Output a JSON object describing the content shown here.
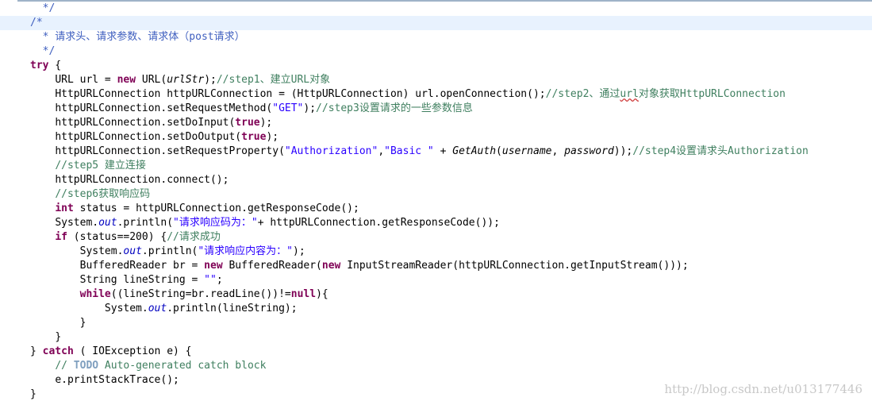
{
  "colors": {
    "keyword": "#7f0055",
    "comment": "#3f7f5f",
    "javadoc": "#3f5fbf",
    "string": "#2a00ff",
    "field": "#0000c0",
    "todo": "#7f9fbf",
    "highlight": "#e8f2fe",
    "watermark": "#c8c8c8"
  },
  "watermark": "http://blog.csdn.net/u013177446",
  "lines": [
    {
      "indent": "  ",
      "tokens": [
        {
          "c": "jd",
          "t": "*/"
        }
      ]
    },
    {
      "indent": "",
      "hl": true,
      "tokens": [
        {
          "c": "jd",
          "t": "/*"
        }
      ]
    },
    {
      "indent": "  ",
      "tokens": [
        {
          "c": "jd",
          "t": "* 请求头、请求参数、请求体（post请求）"
        }
      ]
    },
    {
      "indent": "  ",
      "tokens": [
        {
          "c": "jd",
          "t": "*/"
        }
      ]
    },
    {
      "indent": "",
      "tokens": [
        {
          "c": "kw",
          "t": "try"
        },
        {
          "c": "",
          "t": " {"
        }
      ]
    },
    {
      "indent": "    ",
      "tokens": [
        {
          "c": "",
          "t": "URL url = "
        },
        {
          "c": "kw",
          "t": "new"
        },
        {
          "c": "",
          "t": " URL("
        },
        {
          "c": "it",
          "t": "urlStr"
        },
        {
          "c": "",
          "t": ");"
        },
        {
          "c": "cm",
          "t": "//step1、建立URL对象"
        }
      ]
    },
    {
      "indent": "    ",
      "tokens": [
        {
          "c": "",
          "t": "HttpURLConnection httpURLConnection = (HttpURLConnection) url.openConnection();"
        },
        {
          "c": "cm",
          "t": "//step2、通过"
        },
        {
          "c": "cm uline",
          "t": "url"
        },
        {
          "c": "cm",
          "t": "对象获取HttpURLConnection"
        }
      ]
    },
    {
      "indent": "    ",
      "tokens": [
        {
          "c": "",
          "t": "httpURLConnection.setRequestMethod("
        },
        {
          "c": "str",
          "t": "\"GET\""
        },
        {
          "c": "",
          "t": ");"
        },
        {
          "c": "cm",
          "t": "//step3设置请求的一些参数信息"
        }
      ]
    },
    {
      "indent": "    ",
      "tokens": [
        {
          "c": "",
          "t": "httpURLConnection.setDoInput("
        },
        {
          "c": "kw",
          "t": "true"
        },
        {
          "c": "",
          "t": ");"
        }
      ]
    },
    {
      "indent": "    ",
      "tokens": [
        {
          "c": "",
          "t": "httpURLConnection.setDoOutput("
        },
        {
          "c": "kw",
          "t": "true"
        },
        {
          "c": "",
          "t": ");"
        }
      ]
    },
    {
      "indent": "    ",
      "tokens": [
        {
          "c": "",
          "t": "httpURLConnection.setRequestProperty("
        },
        {
          "c": "str",
          "t": "\"Authorization\""
        },
        {
          "c": "",
          "t": ","
        },
        {
          "c": "str",
          "t": "\"Basic \""
        },
        {
          "c": "",
          "t": " + "
        },
        {
          "c": "it",
          "t": "GetAuth"
        },
        {
          "c": "",
          "t": "("
        },
        {
          "c": "it",
          "t": "username"
        },
        {
          "c": "",
          "t": ", "
        },
        {
          "c": "it",
          "t": "password"
        },
        {
          "c": "",
          "t": "));"
        },
        {
          "c": "cm",
          "t": "//step4设置请求头Authorization"
        }
      ]
    },
    {
      "indent": "    ",
      "tokens": [
        {
          "c": "cm",
          "t": "//step5 建立连接"
        }
      ]
    },
    {
      "indent": "    ",
      "tokens": [
        {
          "c": "",
          "t": "httpURLConnection.connect();"
        }
      ]
    },
    {
      "indent": "    ",
      "tokens": [
        {
          "c": "cm",
          "t": "//step6获取响应码"
        }
      ]
    },
    {
      "indent": "    ",
      "tokens": [
        {
          "c": "kw",
          "t": "int"
        },
        {
          "c": "",
          "t": " status = httpURLConnection.getResponseCode();"
        }
      ]
    },
    {
      "indent": "    ",
      "tokens": [
        {
          "c": "",
          "t": "System."
        },
        {
          "c": "fld",
          "t": "out"
        },
        {
          "c": "",
          "t": ".println("
        },
        {
          "c": "str",
          "t": "\"请求响应码为：\""
        },
        {
          "c": "",
          "t": "+ httpURLConnection.getResponseCode());"
        }
      ]
    },
    {
      "indent": "    ",
      "tokens": [
        {
          "c": "kw",
          "t": "if"
        },
        {
          "c": "",
          "t": " (status==200) {"
        },
        {
          "c": "cm",
          "t": "//请求成功"
        }
      ]
    },
    {
      "indent": "        ",
      "tokens": [
        {
          "c": "",
          "t": "System."
        },
        {
          "c": "fld",
          "t": "out"
        },
        {
          "c": "",
          "t": ".println("
        },
        {
          "c": "str",
          "t": "\"请求响应内容为：\""
        },
        {
          "c": "",
          "t": ");"
        }
      ]
    },
    {
      "indent": "        ",
      "tokens": [
        {
          "c": "",
          "t": "BufferedReader br = "
        },
        {
          "c": "kw",
          "t": "new"
        },
        {
          "c": "",
          "t": " BufferedReader("
        },
        {
          "c": "kw",
          "t": "new"
        },
        {
          "c": "",
          "t": " InputStreamReader(httpURLConnection.getInputStream()));"
        }
      ]
    },
    {
      "indent": "        ",
      "tokens": [
        {
          "c": "",
          "t": "String lineString = "
        },
        {
          "c": "str",
          "t": "\"\""
        },
        {
          "c": "",
          "t": ";"
        }
      ]
    },
    {
      "indent": "        ",
      "tokens": [
        {
          "c": "kw",
          "t": "while"
        },
        {
          "c": "",
          "t": "((lineString=br.readLine())!="
        },
        {
          "c": "kw",
          "t": "null"
        },
        {
          "c": "",
          "t": "){"
        }
      ]
    },
    {
      "indent": "            ",
      "tokens": [
        {
          "c": "",
          "t": "System."
        },
        {
          "c": "fld",
          "t": "out"
        },
        {
          "c": "",
          "t": ".println(lineString);"
        }
      ]
    },
    {
      "indent": "        ",
      "tokens": [
        {
          "c": "",
          "t": "}"
        }
      ]
    },
    {
      "indent": "    ",
      "tokens": [
        {
          "c": "",
          "t": "}"
        }
      ]
    },
    {
      "indent": "",
      "tokens": [
        {
          "c": "",
          "t": "} "
        },
        {
          "c": "kw",
          "t": "catch"
        },
        {
          "c": "",
          "t": " ( IOException e) {"
        }
      ]
    },
    {
      "indent": "    ",
      "tokens": [
        {
          "c": "cm",
          "t": "// "
        },
        {
          "c": "todo",
          "t": "TODO"
        },
        {
          "c": "cm",
          "t": " Auto-generated catch block"
        }
      ]
    },
    {
      "indent": "    ",
      "tokens": [
        {
          "c": "",
          "t": "e.printStackTrace();"
        }
      ]
    },
    {
      "indent": "",
      "tokens": [
        {
          "c": "",
          "t": "}"
        }
      ]
    }
  ]
}
